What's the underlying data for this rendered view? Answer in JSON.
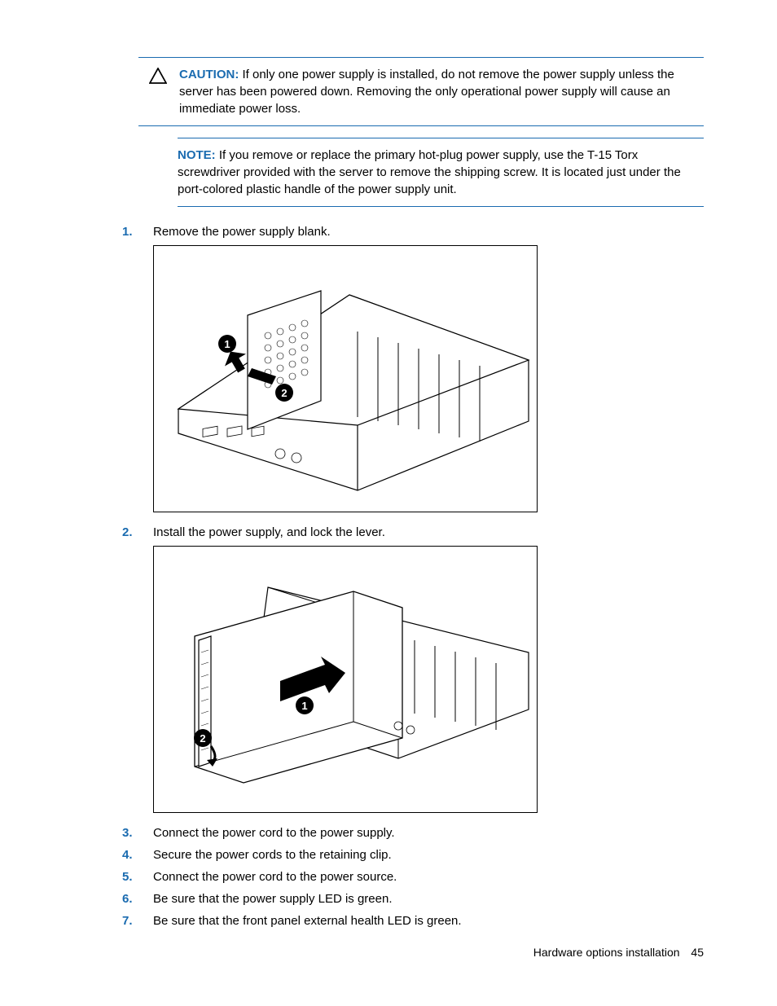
{
  "caution": {
    "label": "CAUTION:",
    "text": "If only one power supply is installed, do not remove the power supply unless the server has been powered down. Removing the only operational power supply will cause an immediate power loss."
  },
  "note": {
    "label": "NOTE:",
    "text": "If you remove or replace the primary hot-plug power supply, use the T-15 Torx screwdriver provided with the server to remove the shipping screw. It is located just under the port-colored plastic handle of the power supply unit."
  },
  "steps": [
    {
      "num": "1.",
      "text": "Remove the power supply blank."
    },
    {
      "num": "2.",
      "text": "Install the power supply, and lock the lever."
    },
    {
      "num": "3.",
      "text": "Connect the power cord to the power supply."
    },
    {
      "num": "4.",
      "text": "Secure the power cords to the retaining clip."
    },
    {
      "num": "5.",
      "text": "Connect the power cord to the power source."
    },
    {
      "num": "6.",
      "text": "Be sure that the power supply LED is green."
    },
    {
      "num": "7.",
      "text": "Be sure that the front panel external health LED is green."
    }
  ],
  "footer": {
    "section": "Hardware options installation",
    "page": "45"
  }
}
